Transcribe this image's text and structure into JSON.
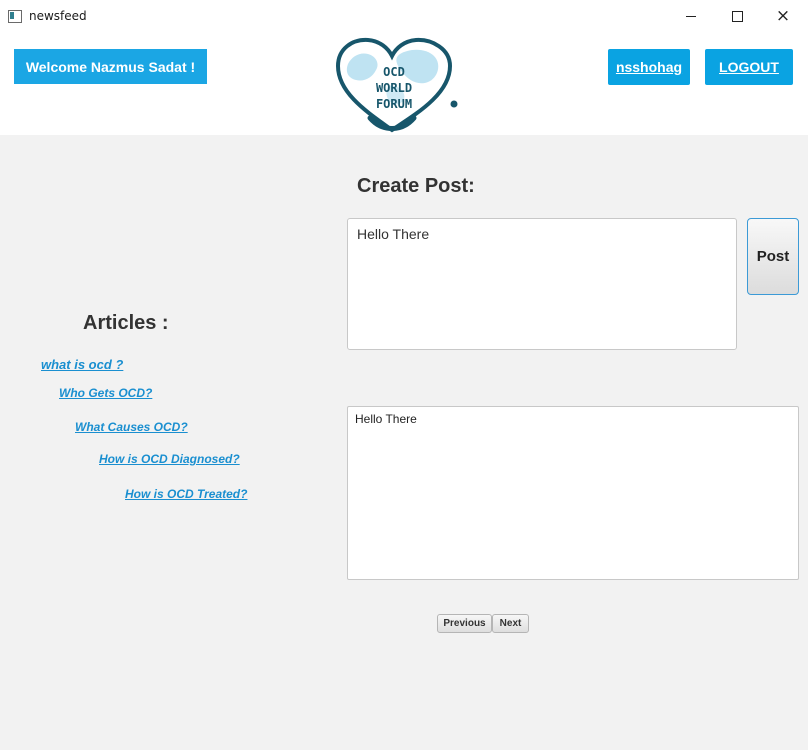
{
  "window": {
    "title": "newsfeed",
    "controls": {
      "minimize": "minimize",
      "maximize": "maximize",
      "close": "×"
    }
  },
  "header": {
    "welcome": "Welcome Nazmus Sadat !",
    "logo": {
      "line1": "OCD",
      "line2": "WORLD",
      "line3": "FORUM"
    },
    "username": "nsshohag",
    "logout": "LOGOUT"
  },
  "create_post": {
    "title": "Create Post:",
    "input_value": "Hello There",
    "post_button": "Post"
  },
  "articles": {
    "title": "Articles :",
    "links": [
      "what is ocd ?",
      "Who Gets OCD?",
      "What Causes OCD?",
      "How is OCD Diagnosed?",
      "How is OCD Treated?"
    ]
  },
  "feed": {
    "text": "Hello There"
  },
  "pagination": {
    "previous": "Previous",
    "next": "Next"
  },
  "colors": {
    "accent": "#0aa3e2",
    "link": "#1a8fd0",
    "logo_teal": "#17566b"
  }
}
